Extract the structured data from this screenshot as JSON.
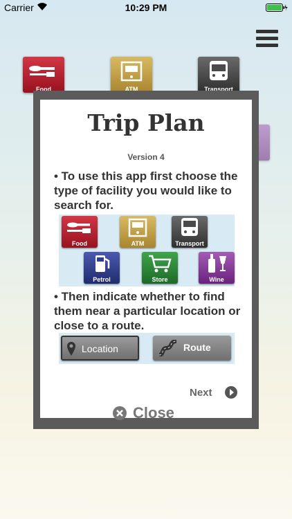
{
  "status_bar": {
    "carrier": "Carrier",
    "time": "10:29 PM"
  },
  "background_tiles": [
    {
      "label": "Food",
      "color": "#b81f2f"
    },
    {
      "label": "ATM",
      "color": "#c9a84a"
    },
    {
      "label": "Transport",
      "color": "#4a4a4a"
    }
  ],
  "modal": {
    "title": "Trip Plan",
    "version": "Version 4",
    "bullet1": "• To use this app first choose the type of facility you would like to search for.",
    "bullet2": "• Then indicate whether to find them near a particular location or close to a route.",
    "facilities": [
      {
        "label": "Food",
        "color": "#b81f2f"
      },
      {
        "label": "ATM",
        "color": "#c9a84a"
      },
      {
        "label": "Transport",
        "color": "#4a4a4a"
      },
      {
        "label": "Petrol",
        "color": "#2d3e8c"
      },
      {
        "label": "Store",
        "color": "#2f8a3a"
      },
      {
        "label": "Wine",
        "color": "#7a2a8e"
      }
    ],
    "location_label": "Location",
    "route_label": "Route",
    "next_label": "Next",
    "close_label": "Close"
  }
}
